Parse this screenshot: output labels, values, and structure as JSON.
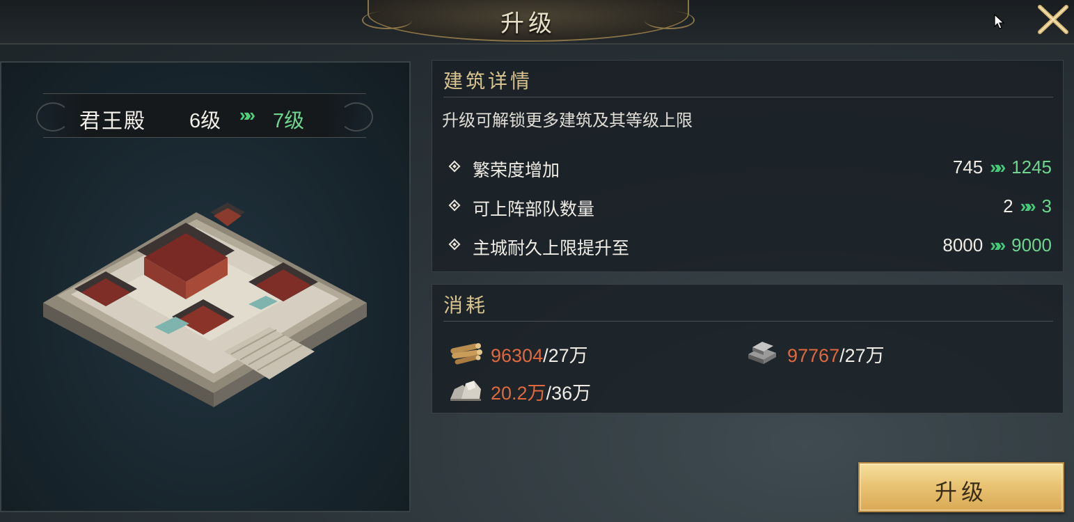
{
  "header": {
    "title": "升级"
  },
  "building": {
    "name": "君王殿",
    "current_level": "6级",
    "next_level": "7级",
    "arrow": "»"
  },
  "details": {
    "title": "建筑详情",
    "description": "升级可解锁更多建筑及其等级上限",
    "stats": [
      {
        "label": "繁荣度增加",
        "current": "745",
        "next": "1245"
      },
      {
        "label": "可上阵部队数量",
        "current": "2",
        "next": "3"
      },
      {
        "label": "主城耐久上限提升至",
        "current": "8000",
        "next": "9000"
      }
    ]
  },
  "cost": {
    "title": "消耗",
    "items": [
      {
        "icon": "wood-logs-icon",
        "have": "96304",
        "need": "/27万"
      },
      {
        "icon": "iron-ingot-icon",
        "have": "97767",
        "need": "/27万"
      },
      {
        "icon": "stone-icon",
        "have": "20.2万",
        "need": "/36万"
      }
    ]
  },
  "actions": {
    "upgrade_label": "升级"
  },
  "colors": {
    "gold": "#d9c48f",
    "green": "#6ed68f",
    "insufficient": "#e0683f",
    "button": "#e9c474"
  }
}
